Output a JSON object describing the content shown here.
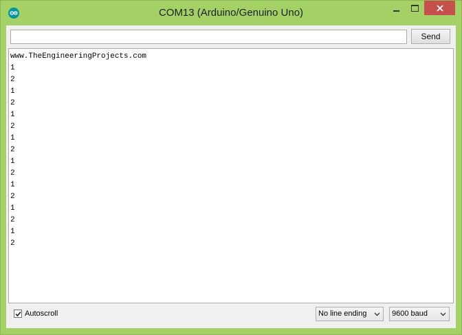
{
  "window": {
    "title": "COM13 (Arduino/Genuino Uno)"
  },
  "send": {
    "input_value": "",
    "button_label": "Send"
  },
  "output": {
    "lines": [
      "www.TheEngineeringProjects.com",
      "1",
      "2",
      "1",
      "2",
      "1",
      "2",
      "1",
      "2",
      "1",
      "2",
      "1",
      "2",
      "1",
      "2",
      "1",
      "2"
    ]
  },
  "footer": {
    "autoscroll_label": "Autoscroll",
    "autoscroll_checked": true,
    "line_ending": "No line ending",
    "baud_rate": "9600 baud"
  },
  "colors": {
    "frame": "#a4d166",
    "close": "#c7504d",
    "arduino_teal": "#00979d"
  },
  "icons": {
    "app": "arduino-icon",
    "minimize": "minimize-icon",
    "maximize": "maximize-icon",
    "close": "close-icon",
    "check": "check-icon",
    "dropdown": "chevron-down-icon"
  }
}
